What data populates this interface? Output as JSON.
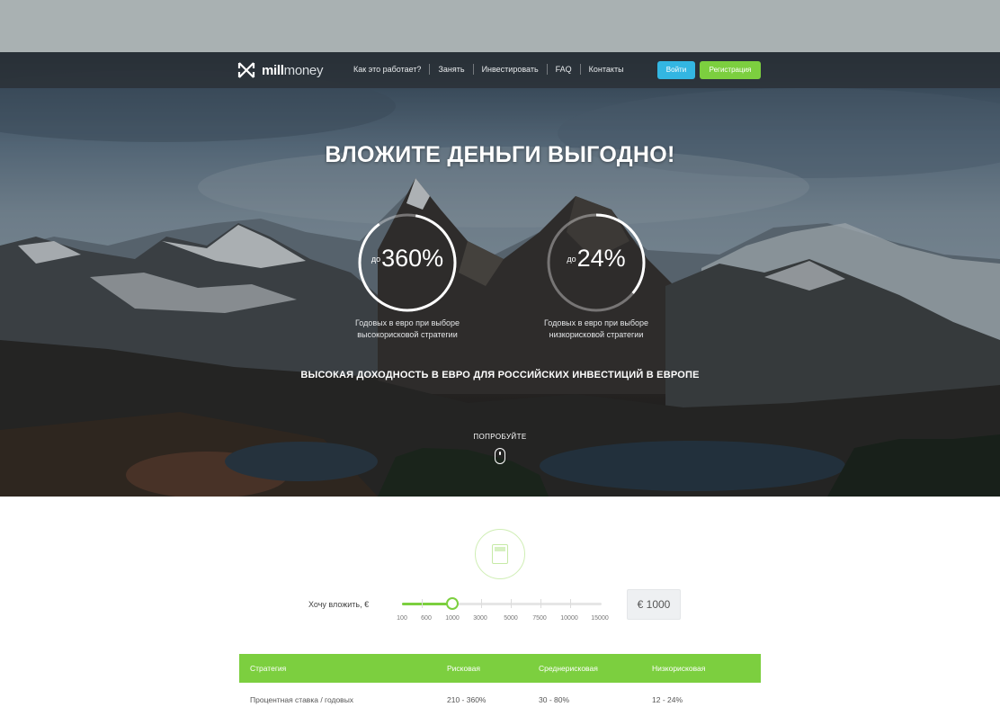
{
  "header": {
    "logo_bold": "mill",
    "logo_light": "money",
    "nav": [
      "Как это работает?",
      "Занять",
      "Инвестировать",
      "FAQ",
      "Контакты"
    ],
    "login_label": "Войти",
    "register_label": "Регистрация"
  },
  "hero": {
    "title": "ВЛОЖИТЕ ДЕНЬГИ ВЫГОДНО!",
    "ring1": {
      "prefix": "до",
      "value": "360%",
      "caption_line1": "Годовых в евро при выборе",
      "caption_line2": "высокорисковой стратегии"
    },
    "ring2": {
      "prefix": "до",
      "value": "24%",
      "caption_line1": "Годовых в евро при выборе",
      "caption_line2": "низкорисковой стратегии"
    },
    "subtitle": "ВЫСОКАЯ ДОХОДНОСТЬ В ЕВРО ДЛЯ РОССИЙСКИХ ИНВЕСТИЦИЙ В ЕВРОПЕ",
    "try_label": "ПОПРОБУЙТЕ"
  },
  "calculator": {
    "want_label": "Хочу вложить, €",
    "ticks": [
      "100",
      "600",
      "1000",
      "3000",
      "5000",
      "7500",
      "10000",
      "15000"
    ],
    "amount": "€ 1000"
  },
  "table": {
    "headers": [
      "Стратегия",
      "Рисковая",
      "Среднерисковая",
      "Низкорисковая"
    ],
    "rows": [
      [
        "Процентная ставка / годовых",
        "210 - 360%",
        "30 - 80%",
        "12 - 24%"
      ]
    ]
  },
  "colors": {
    "accent_green": "#7ccf3f",
    "accent_blue": "#33b6e2"
  }
}
